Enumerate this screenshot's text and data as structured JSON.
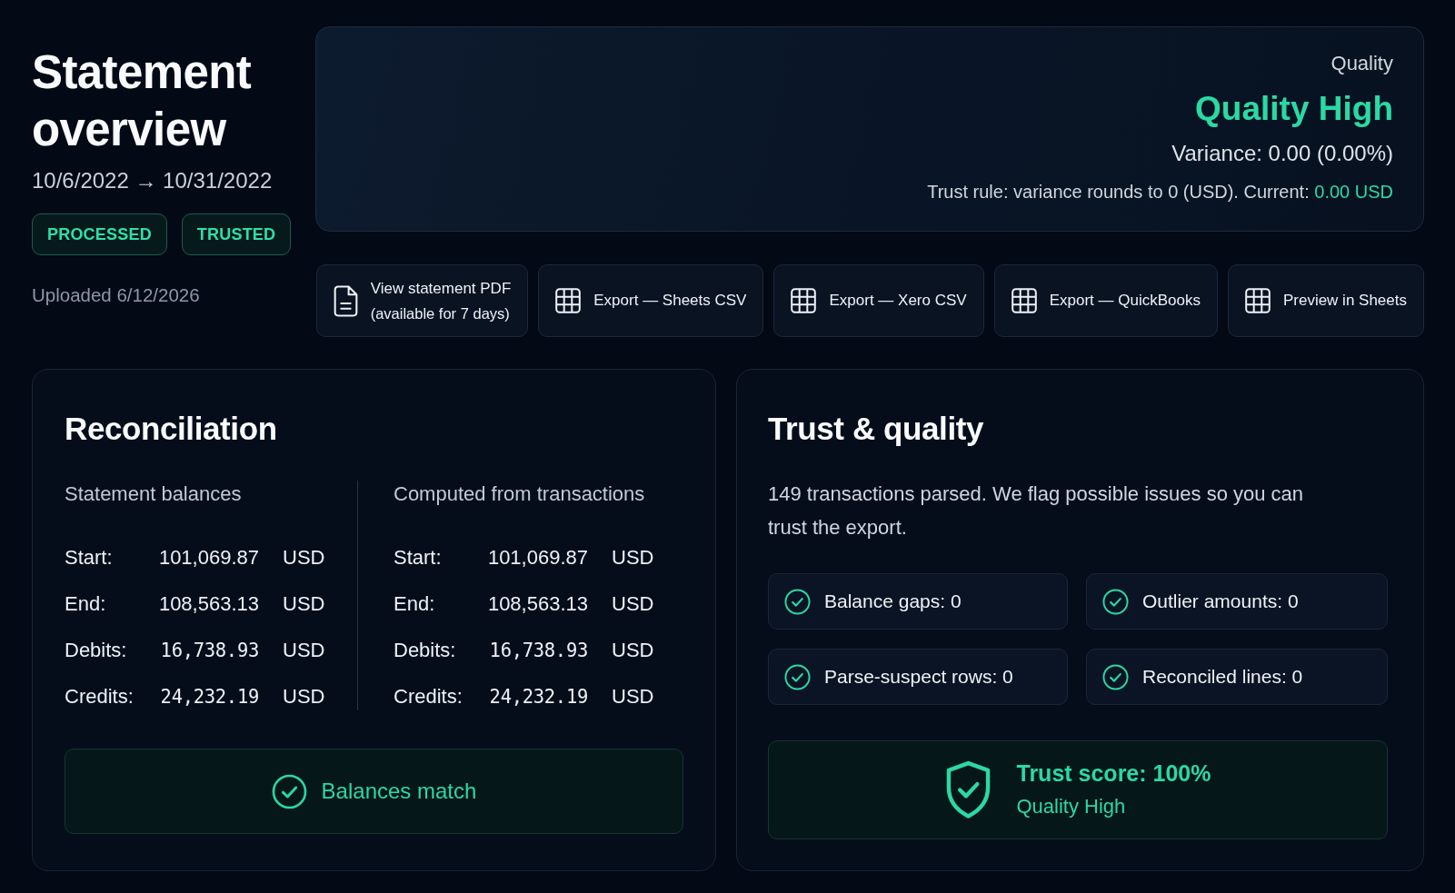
{
  "header": {
    "title": "Statement overview",
    "date_range": "10/6/2022 → 10/31/2022",
    "badges": [
      "PROCESSED",
      "TRUSTED"
    ]
  },
  "quality_card": {
    "label": "Quality",
    "quality": "Quality High",
    "variance": "Variance: 0.00 (0.00%)",
    "trust_rule": "Trust rule: variance rounds to 0 (USD). Current:",
    "current": "0.00 USD"
  },
  "uploaded": "Uploaded 6/12/2026",
  "actions": [
    {
      "kind": "document",
      "label": "View statement PDF",
      "note": "(available for 7 days)"
    },
    {
      "kind": "grid",
      "label": "Export — Sheets CSV"
    },
    {
      "kind": "grid",
      "label": "Export — Xero CSV"
    },
    {
      "kind": "grid",
      "label": "Export — QuickBooks"
    },
    {
      "kind": "grid",
      "label": "Preview in Sheets"
    }
  ],
  "reconciliation": {
    "title": "Reconciliation",
    "sections": [
      {
        "heading": "Statement balances",
        "rows": [
          {
            "label": "Start:",
            "value": "101,069.87",
            "currency": "USD",
            "monospace": false
          },
          {
            "label": "End:",
            "value": "108,563.13",
            "currency": "USD",
            "monospace": false
          },
          {
            "label": "Debits:",
            "value": "16,738.93",
            "currency": "USD",
            "monospace": true
          },
          {
            "label": "Credits:",
            "value": "24,232.19",
            "currency": "USD",
            "monospace": true
          }
        ]
      },
      {
        "heading": "Computed from transactions",
        "rows": [
          {
            "label": "Start:",
            "value": "101,069.87",
            "currency": "USD",
            "monospace": false
          },
          {
            "label": "End:",
            "value": "108,563.13",
            "currency": "USD",
            "monospace": false
          },
          {
            "label": "Debits:",
            "value": "16,738.93",
            "currency": "USD",
            "monospace": true
          },
          {
            "label": "Credits:",
            "value": "24,232.19",
            "currency": "USD",
            "monospace": true
          }
        ]
      }
    ],
    "status": {
      "text": "Balances match",
      "matched": true
    }
  },
  "trust": {
    "title": "Trust & quality",
    "description": "149 transactions parsed. We flag possible issues so you can trust the export.",
    "checks": [
      {
        "label": "Balance gaps: 0",
        "passed": true
      },
      {
        "label": "Outlier amounts: 0",
        "passed": true
      },
      {
        "label": "Parse-suspect rows: 0",
        "passed": true
      },
      {
        "label": "Reconciled lines: 0",
        "passed": true
      }
    ],
    "score": {
      "text": "Trust score: 100%",
      "quality": "Quality High"
    }
  }
}
